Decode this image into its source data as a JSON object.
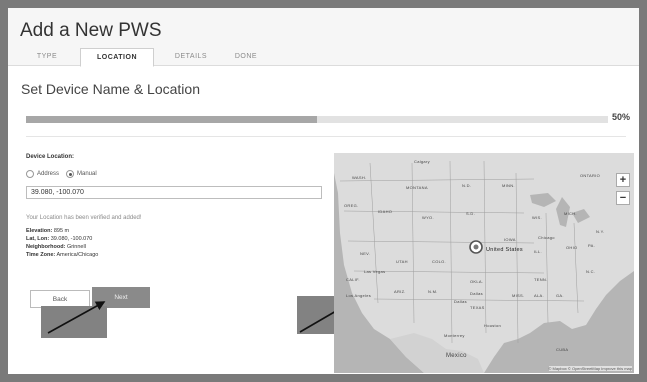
{
  "header": {
    "title": "Add a New PWS"
  },
  "tabs": [
    {
      "label": "TYPE",
      "active": false
    },
    {
      "label": "LOCATION",
      "active": true
    },
    {
      "label": "DETAILS",
      "active": false
    },
    {
      "label": "DONE",
      "active": false
    }
  ],
  "main": {
    "subtitle": "Set Device Name & Location",
    "progress": {
      "percent": 50,
      "label": "50%"
    },
    "device_location_label": "Device Location:",
    "radio_options": [
      {
        "label": "Address",
        "selected": false
      },
      {
        "label": "Manual",
        "selected": true
      }
    ],
    "coordinates_value": "39.080, -100.070",
    "verified_message": "Your Location has been verified and added!",
    "info": {
      "elevation_label": "Elevation:",
      "elevation_value": "895 m",
      "latlon_label": "Lat, Lon:",
      "latlon_value": "39.080, -100.070",
      "neighborhood_label": "Neighborhood:",
      "neighborhood_value": "Grinnell",
      "timezone_label": "Time Zone:",
      "timezone_value": "America/Chicago"
    },
    "buttons": {
      "back": "Back",
      "next": "Next"
    }
  },
  "map": {
    "zoom_in": "+",
    "zoom_out": "−",
    "attribution": "© Mapbox © OpenStreetMap Improve this map",
    "labels": [
      {
        "text": "Calgary"
      },
      {
        "text": "WASH."
      },
      {
        "text": "MONTANA"
      },
      {
        "text": "N.D."
      },
      {
        "text": "MINN."
      },
      {
        "text": "ONTARIO"
      },
      {
        "text": "OREG."
      },
      {
        "text": "IDAHO"
      },
      {
        "text": "WYO."
      },
      {
        "text": "S.D."
      },
      {
        "text": "WIS."
      },
      {
        "text": "MICH."
      },
      {
        "text": "NEV."
      },
      {
        "text": "UTAH"
      },
      {
        "text": "COLO."
      },
      {
        "text": "IOWA"
      },
      {
        "text": "ILL."
      },
      {
        "text": "OHIO"
      },
      {
        "text": "CALIF."
      },
      {
        "text": "ARIZ."
      },
      {
        "text": "N.M."
      },
      {
        "text": "OKLA."
      },
      {
        "text": "TENN."
      },
      {
        "text": "N.C."
      },
      {
        "text": "Las Vegas"
      },
      {
        "text": "Los Angeles"
      },
      {
        "text": "TEXAS"
      },
      {
        "text": "Dallas"
      },
      {
        "text": "MISS."
      },
      {
        "text": "ALA."
      },
      {
        "text": "GA."
      },
      {
        "text": "Mexico"
      },
      {
        "text": "United States"
      },
      {
        "text": "Chicago"
      },
      {
        "text": "Houston"
      },
      {
        "text": "Monterrey"
      },
      {
        "text": "CUBA"
      },
      {
        "text": "Dallas"
      },
      {
        "text": "N.Y."
      },
      {
        "text": "PA."
      }
    ]
  }
}
